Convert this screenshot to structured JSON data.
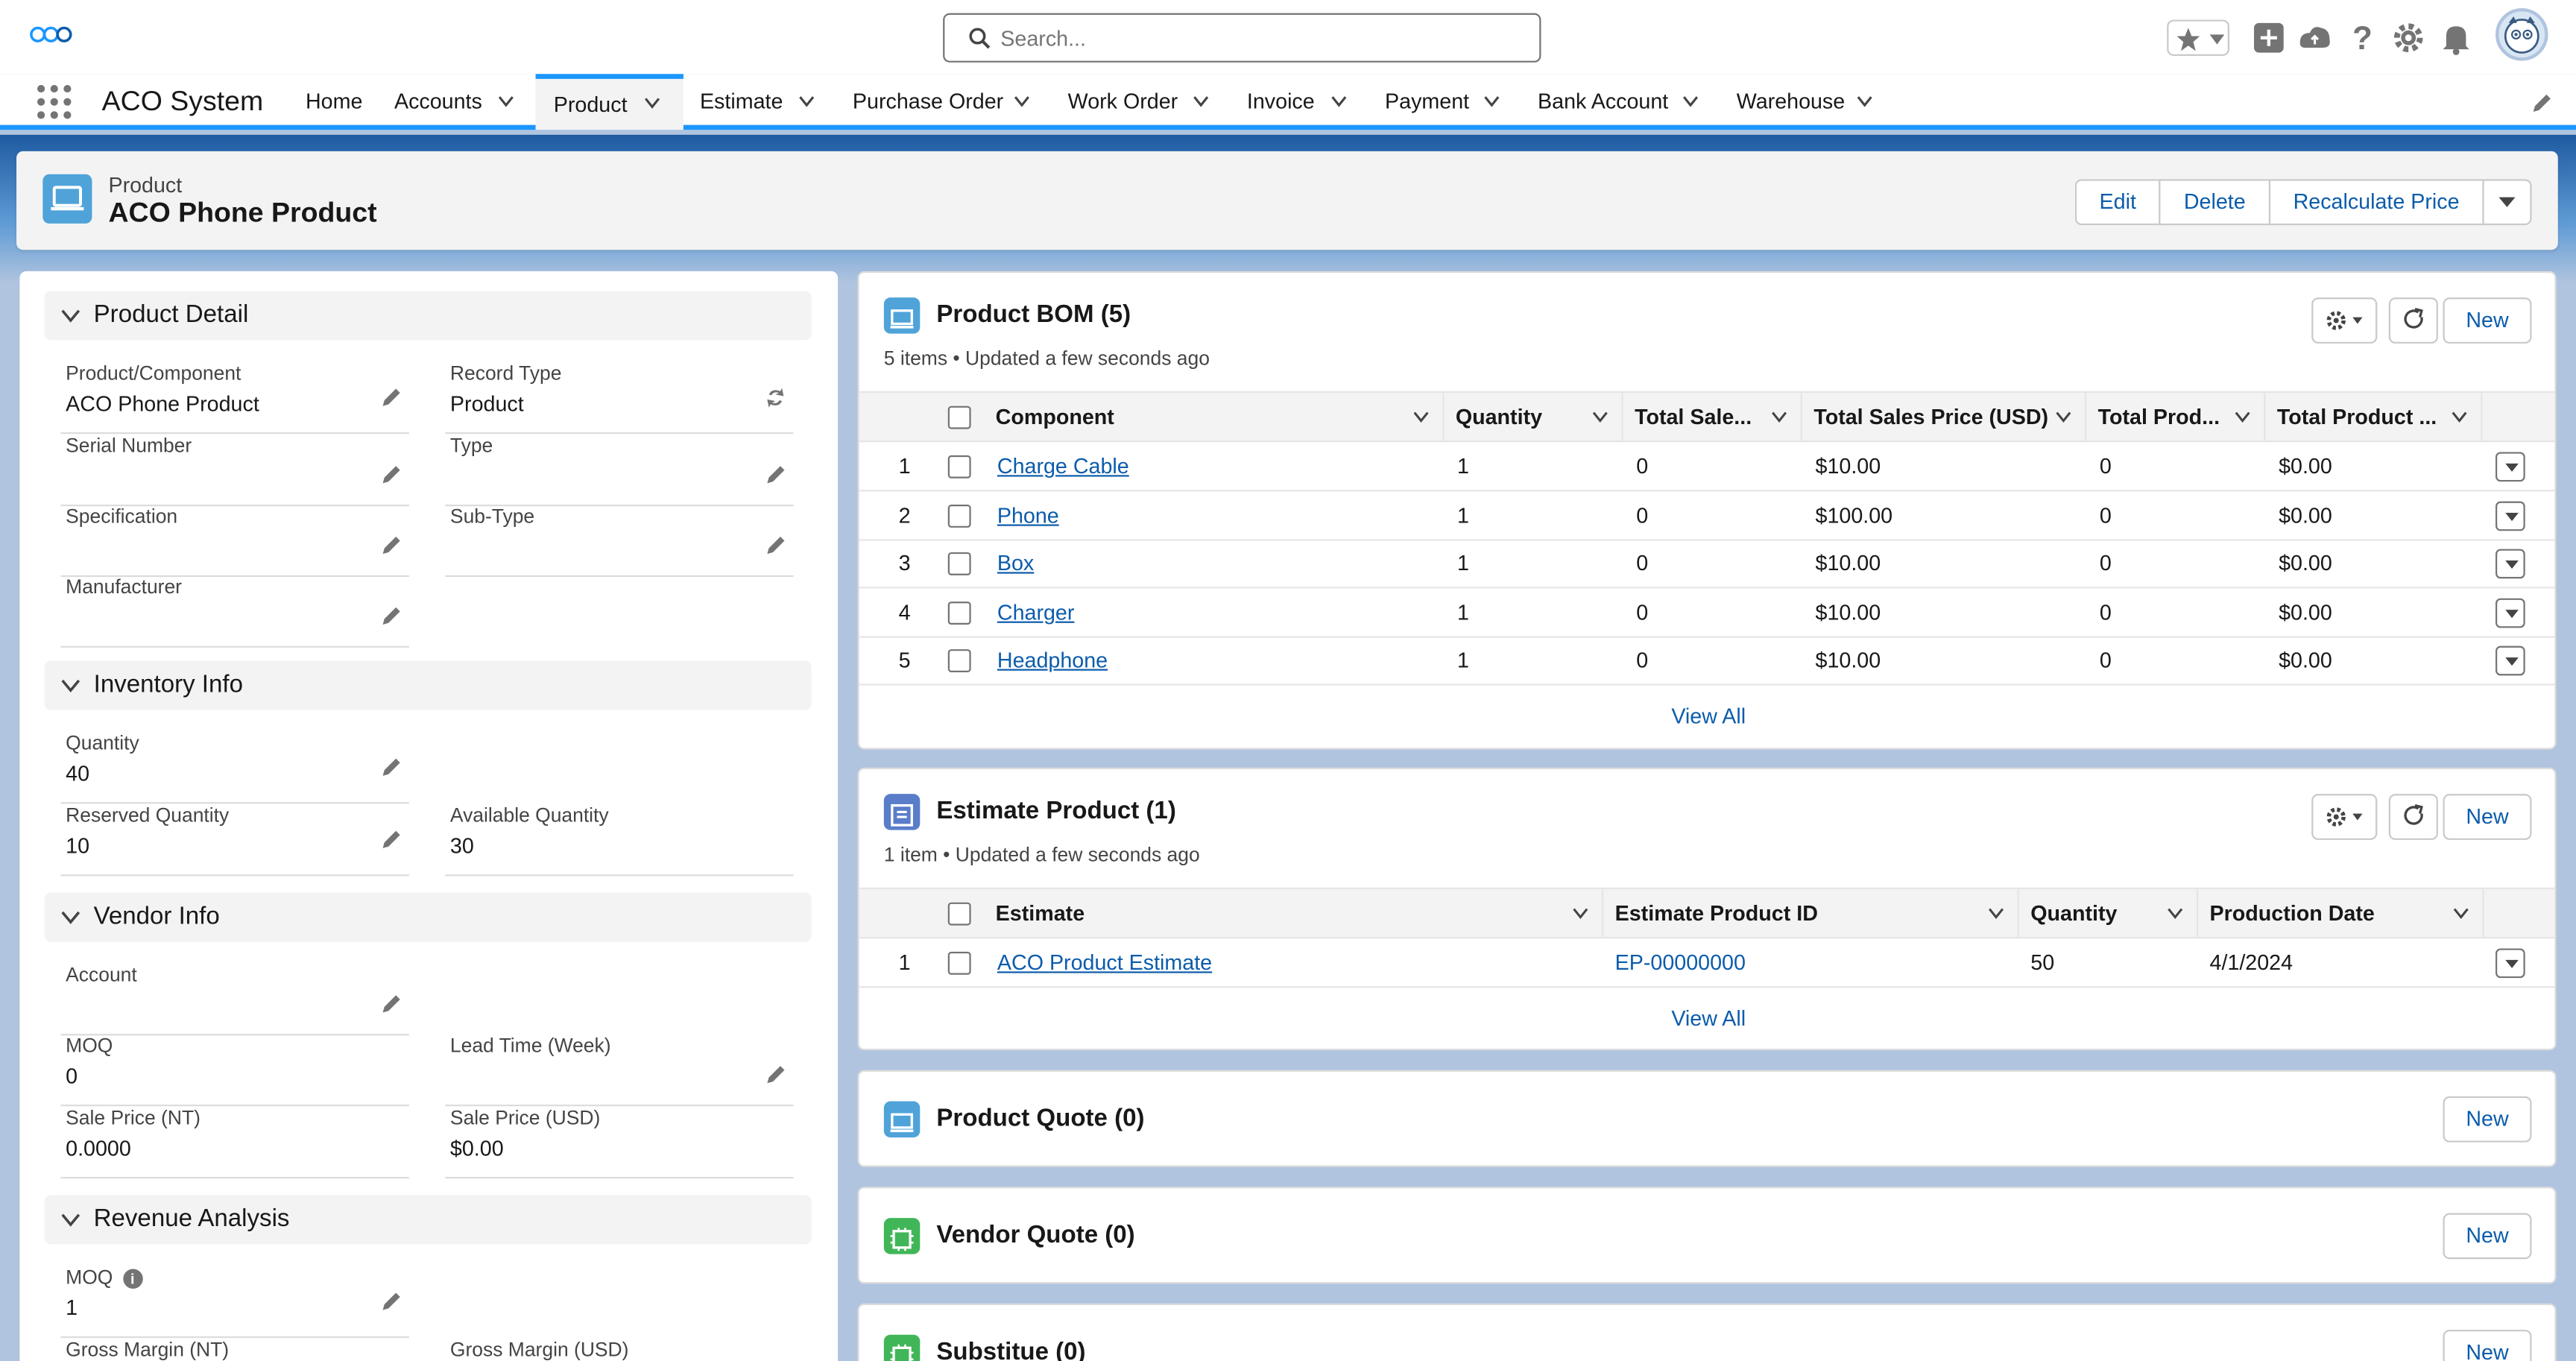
{
  "header": {
    "search_placeholder": "Search...",
    "icons": [
      "star-favorites-icon",
      "add-icon",
      "trailhead-icon",
      "help-icon",
      "setup-gear-icon",
      "notifications-bell-icon",
      "avatar"
    ]
  },
  "nav": {
    "app_name": "ACO System",
    "items": [
      {
        "label": "Home",
        "has_menu": false
      },
      {
        "label": "Accounts",
        "has_menu": true
      },
      {
        "label": "Product",
        "has_menu": true,
        "active": true
      },
      {
        "label": "Estimate",
        "has_menu": true
      },
      {
        "label": "Purchase Order",
        "has_menu": true
      },
      {
        "label": "Work Order",
        "has_menu": true
      },
      {
        "label": "Invoice",
        "has_menu": true
      },
      {
        "label": "Payment",
        "has_menu": true
      },
      {
        "label": "Bank Account",
        "has_menu": true
      },
      {
        "label": "Warehouse",
        "has_menu": true
      }
    ]
  },
  "record": {
    "object_label": "Product",
    "name": "ACO Phone Product",
    "actions": [
      "Edit",
      "Delete",
      "Recalculate Price"
    ]
  },
  "detail": {
    "product_detail": {
      "title": "Product Detail",
      "fields": [
        {
          "label": "Product/Component",
          "value": "ACO Phone Product"
        },
        {
          "label": "Record Type",
          "value": "Product"
        },
        {
          "label": "Serial Number",
          "value": ""
        },
        {
          "label": "Type",
          "value": ""
        },
        {
          "label": "Specification",
          "value": ""
        },
        {
          "label": "Sub-Type",
          "value": ""
        },
        {
          "label": "Manufacturer",
          "value": ""
        }
      ]
    },
    "inventory_info": {
      "title": "Inventory Info",
      "fields": [
        {
          "label": "Quantity",
          "value": "40"
        },
        {
          "label": "Reserved Quantity",
          "value": "10"
        },
        {
          "label": "Available Quantity",
          "value": "30"
        }
      ]
    },
    "vendor_info": {
      "title": "Vendor Info",
      "fields": [
        {
          "label": "Account",
          "value": ""
        },
        {
          "label": "MOQ",
          "value": "0"
        },
        {
          "label": "Lead Time (Week)",
          "value": ""
        },
        {
          "label": "Sale Price (NT)",
          "value": "0.0000"
        },
        {
          "label": "Sale Price (USD)",
          "value": "$0.00"
        }
      ]
    },
    "revenue_analysis": {
      "title": "Revenue Analysis",
      "fields": [
        {
          "label": "MOQ",
          "value": "1"
        },
        {
          "label": "Gross Margin (NT)",
          "value": ""
        },
        {
          "label": "Gross Margin (USD)",
          "value": ""
        }
      ]
    }
  },
  "product_bom": {
    "title": "Product BOM (5)",
    "meta": "5 items • Updated a few seconds ago",
    "new_label": "New",
    "view_all": "View All",
    "columns": [
      "Component",
      "Quantity",
      "Total Sale...",
      "Total Sales Price (USD)",
      "Total Prod...",
      "Total Product ..."
    ],
    "rows": [
      {
        "num": "1",
        "component": "Charge Cable",
        "quantity": "1",
        "total_sale": "0",
        "total_sales_usd": "$10.00",
        "total_prod": "0",
        "total_product": "$0.00"
      },
      {
        "num": "2",
        "component": "Phone",
        "quantity": "1",
        "total_sale": "0",
        "total_sales_usd": "$100.00",
        "total_prod": "0",
        "total_product": "$0.00"
      },
      {
        "num": "3",
        "component": "Box",
        "quantity": "1",
        "total_sale": "0",
        "total_sales_usd": "$10.00",
        "total_prod": "0",
        "total_product": "$0.00"
      },
      {
        "num": "4",
        "component": "Charger",
        "quantity": "1",
        "total_sale": "0",
        "total_sales_usd": "$10.00",
        "total_prod": "0",
        "total_product": "$0.00"
      },
      {
        "num": "5",
        "component": "Headphone",
        "quantity": "1",
        "total_sale": "0",
        "total_sales_usd": "$10.00",
        "total_prod": "0",
        "total_product": "$0.00"
      }
    ]
  },
  "estimate_product": {
    "title": "Estimate Product (1)",
    "meta": "1 item • Updated a few seconds ago",
    "new_label": "New",
    "view_all": "View All",
    "columns": [
      "Estimate",
      "Estimate Product ID",
      "Quantity",
      "Production Date"
    ],
    "rows": [
      {
        "num": "1",
        "estimate": "ACO Product Estimate",
        "estimate_product_id": "EP-00000000",
        "quantity": "50",
        "production_date": "4/1/2024"
      }
    ]
  },
  "product_quote": {
    "title": "Product Quote (0)",
    "new_label": "New"
  },
  "vendor_quote": {
    "title": "Vendor Quote (0)",
    "new_label": "New"
  },
  "substitue": {
    "title": "Substitue (0)",
    "new_label": "New"
  },
  "colors": {
    "brand_blue": "#0b5cab",
    "accent": "#1b96ff",
    "product_icon": "#4fa3d9",
    "estimate_icon": "#5a7dc9",
    "vendor_icon": "#41b658"
  }
}
